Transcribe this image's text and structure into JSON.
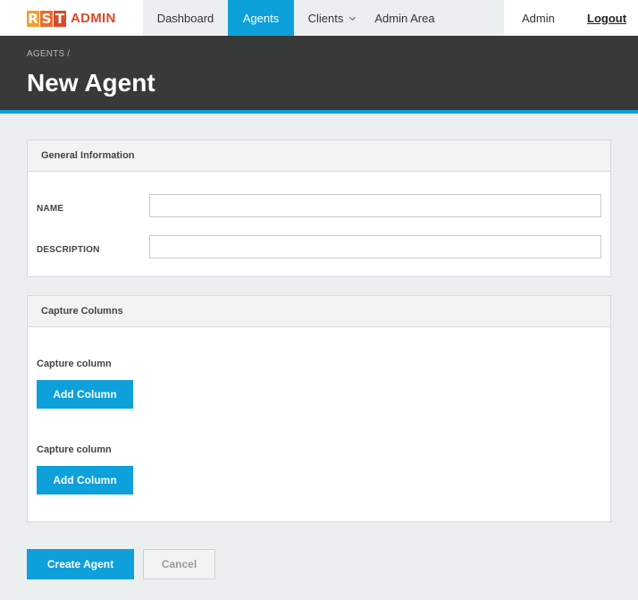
{
  "logo": {
    "letters": [
      "R",
      "S",
      "T"
    ],
    "text": "ADMIN"
  },
  "nav": {
    "items": [
      {
        "label": "Dashboard"
      },
      {
        "label": "Agents",
        "active": true
      },
      {
        "label": "Clients",
        "has_dropdown": true
      },
      {
        "label": "Admin Area"
      }
    ],
    "user": "Admin",
    "logout": "Logout"
  },
  "header": {
    "breadcrumb": "AGENTS  /",
    "title": "New Agent"
  },
  "general": {
    "title": "General Information",
    "name_label": "NAME",
    "name_value": "",
    "description_label": "DESCRIPTION",
    "description_value": ""
  },
  "capture": {
    "title": "Capture Columns",
    "columns": [
      {
        "label": "Capture column",
        "button": "Add Column"
      },
      {
        "label": "Capture column",
        "button": "Add Column"
      }
    ]
  },
  "actions": {
    "create": "Create Agent",
    "cancel": "Cancel"
  },
  "colors": {
    "accent": "#0ea0da",
    "header_bg": "#373a38",
    "logo_r": "#f0a02d",
    "logo_s": "#ec6a2c",
    "logo_t": "#d94a2a"
  }
}
